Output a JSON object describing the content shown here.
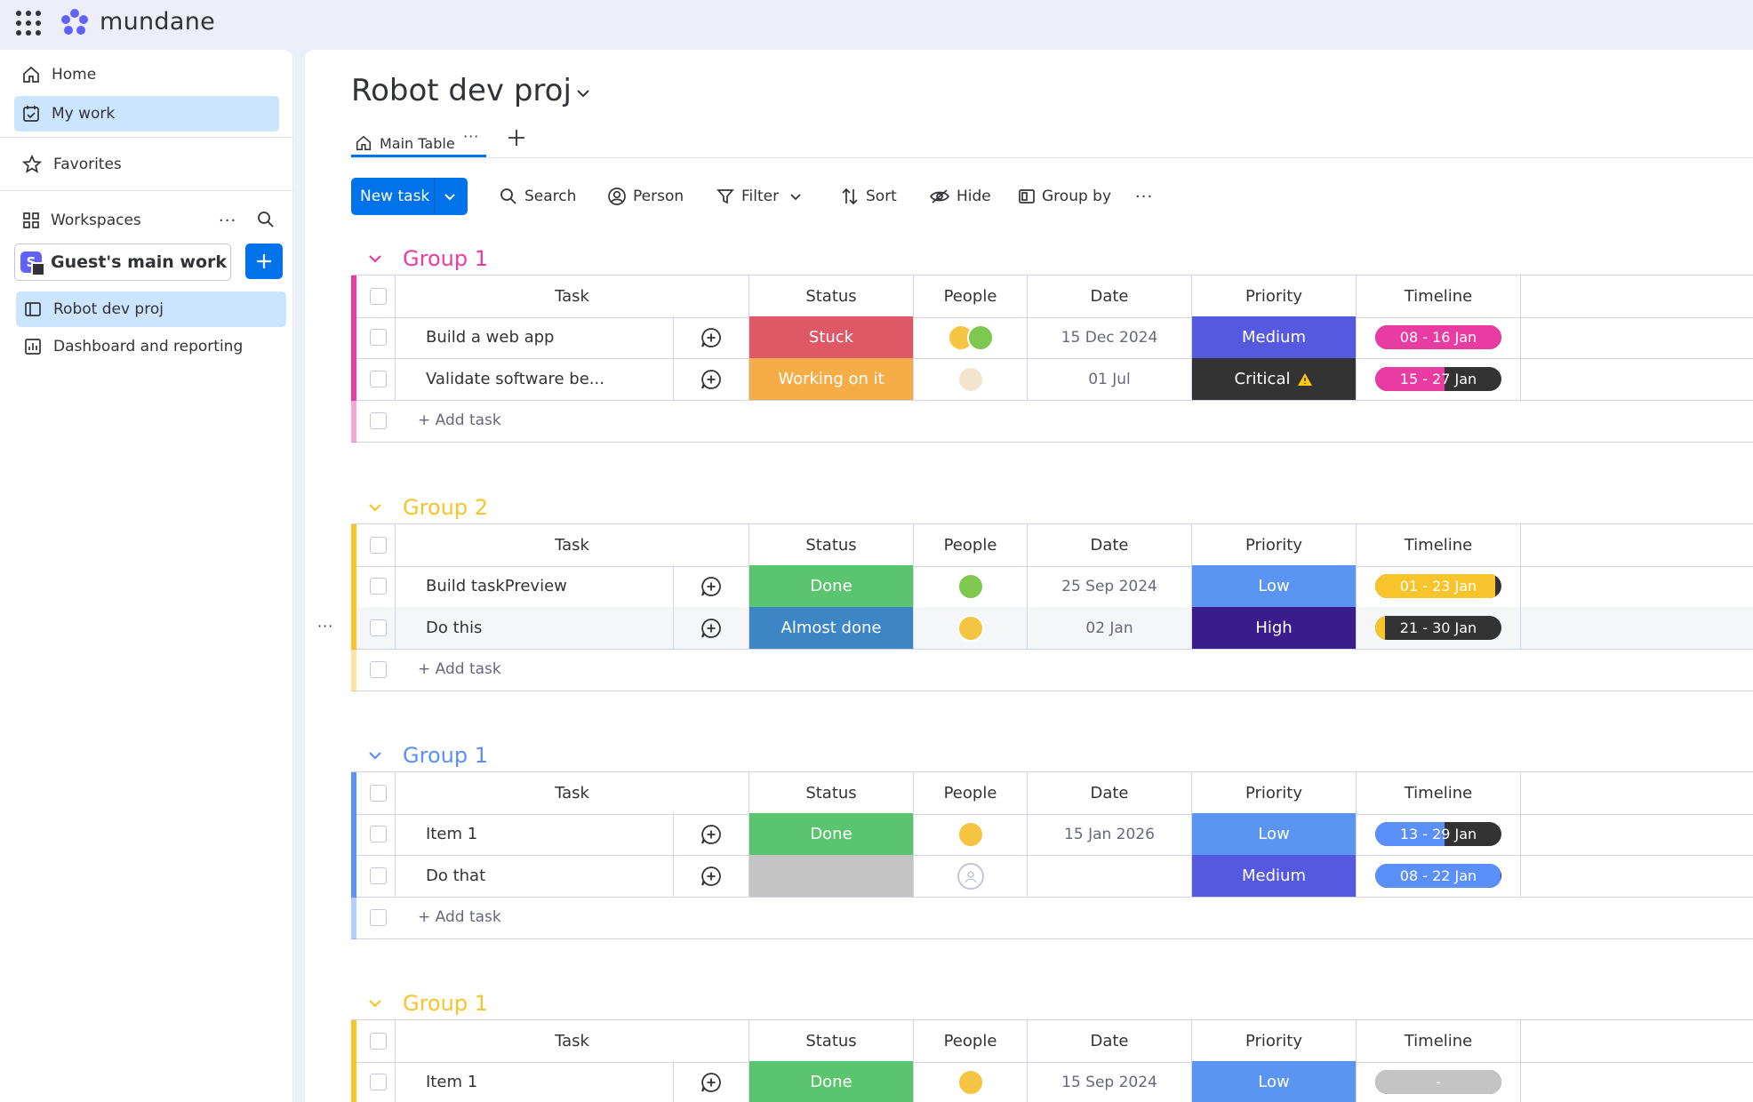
{
  "app": {
    "brand": "mundane"
  },
  "sidebar": {
    "home": "Home",
    "my_work": "My work",
    "favorites": "Favorites",
    "workspaces": "Workspaces",
    "workspace_badge": "S",
    "workspace_name": "Guest's main works...",
    "boards": [
      "Robot dev proj",
      "Dashboard and reporting"
    ]
  },
  "board": {
    "title": "Robot dev proj",
    "tab": "Main Table",
    "toolbar": {
      "new_task": "New task",
      "search": "Search",
      "person": "Person",
      "filter": "Filter",
      "sort": "Sort",
      "hide": "Hide",
      "group_by": "Group by"
    },
    "columns": [
      "Task",
      "Status",
      "People",
      "Date",
      "Priority",
      "Timeline"
    ],
    "add_task": "+ Add task"
  },
  "colors": {
    "stuck": "#e2445c",
    "working": "#fdab3d",
    "done": "#00c875",
    "almost": "#0086c0",
    "medium": "#5559df",
    "critical": "#333333",
    "low": "#579bfc",
    "high": "#401694",
    "pink": "#e2445c",
    "yellow": "#ffcb00",
    "blue": "#579bfc",
    "accent": "#0073ea"
  },
  "groups": [
    {
      "title": "Group 1",
      "color": "#e93ca2",
      "rows": [
        {
          "task": "Build a web app",
          "status": "Stuck",
          "status_color": "#df5866",
          "people": [
            "lion",
            "dino"
          ],
          "date": "15 Dec 2024",
          "priority": "Medium",
          "priority_color": "#5559df",
          "priority_warn": false,
          "timeline": "08 - 16 Jan",
          "timeline_color": "#e93ca2",
          "timeline_progress": 1.0
        },
        {
          "task": "Validate software be...",
          "status": "Working on it",
          "status_color": "#f6ad48",
          "people": [
            "monkey"
          ],
          "date": "01 Jul",
          "priority": "Critical",
          "priority_color": "#333333",
          "priority_warn": true,
          "timeline": "15 - 27 Jan",
          "timeline_color": "#e93ca2",
          "timeline_progress": 0.55
        }
      ]
    },
    {
      "title": "Group 2",
      "color": "#f7c42c",
      "rows": [
        {
          "task": "Build taskPreview",
          "status": "Done",
          "status_color": "#5bc46f",
          "people": [
            "dino"
          ],
          "date": "25 Sep 2024",
          "priority": "Low",
          "priority_color": "#5b95f3",
          "priority_warn": false,
          "timeline": "01 - 23 Jan",
          "timeline_color": "#f7c42c",
          "timeline_progress": 0.95
        },
        {
          "task": "Do this",
          "status": "Almost done",
          "status_color": "#3d86c6",
          "people": [
            "lion"
          ],
          "date": "02 Jan",
          "priority": "High",
          "priority_color": "#3a1c8c",
          "priority_warn": false,
          "timeline": "21 - 30 Jan",
          "timeline_color": "#f7c42c",
          "timeline_progress": 0.08
        }
      ]
    },
    {
      "title": "Group 1",
      "color": "#5b8ff9",
      "rows": [
        {
          "task": "Item 1",
          "status": "Done",
          "status_color": "#5bc46f",
          "people": [
            "lion"
          ],
          "date": "15 Jan 2026",
          "priority": "Low",
          "priority_color": "#5b95f3",
          "priority_warn": false,
          "timeline": "13 - 29 Jan",
          "timeline_color": "#5b8ff9",
          "timeline_progress": 0.55
        },
        {
          "task": "Do that",
          "status": "",
          "status_color": "#c4c4c4",
          "people": [
            "empty"
          ],
          "date": "",
          "priority": "Medium",
          "priority_color": "#5559df",
          "priority_warn": false,
          "timeline": "08 - 22 Jan",
          "timeline_color": "#5b8ff9",
          "timeline_progress": 0.99
        }
      ]
    },
    {
      "title": "Group 1",
      "color": "#f7c42c",
      "rows": [
        {
          "task": "Item 1",
          "status": "Done",
          "status_color": "#5bc46f",
          "people": [
            "lion"
          ],
          "date": "15 Sep 2024",
          "priority": "Low",
          "priority_color": "#5b95f3",
          "priority_warn": false,
          "timeline": "-",
          "timeline_color": "#c4c4c4",
          "timeline_progress": 1.0
        }
      ]
    }
  ]
}
